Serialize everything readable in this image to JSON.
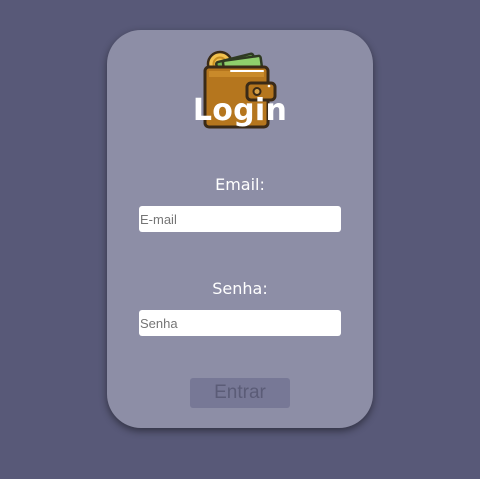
{
  "login": {
    "title": "Login",
    "logo_icon": "wallet-icon",
    "email": {
      "label": "Email:",
      "placeholder": "E-mail",
      "value": ""
    },
    "password": {
      "label": "Senha:",
      "placeholder": "Senha",
      "value": ""
    },
    "submit_label": "Entrar"
  },
  "colors": {
    "background": "#585978",
    "card": "#8d8ea6",
    "button": "#777896",
    "button_text": "#5b5c77",
    "wallet": "#b5761e",
    "banknote": "#8fcf6c",
    "coin": "#f2c14e"
  }
}
